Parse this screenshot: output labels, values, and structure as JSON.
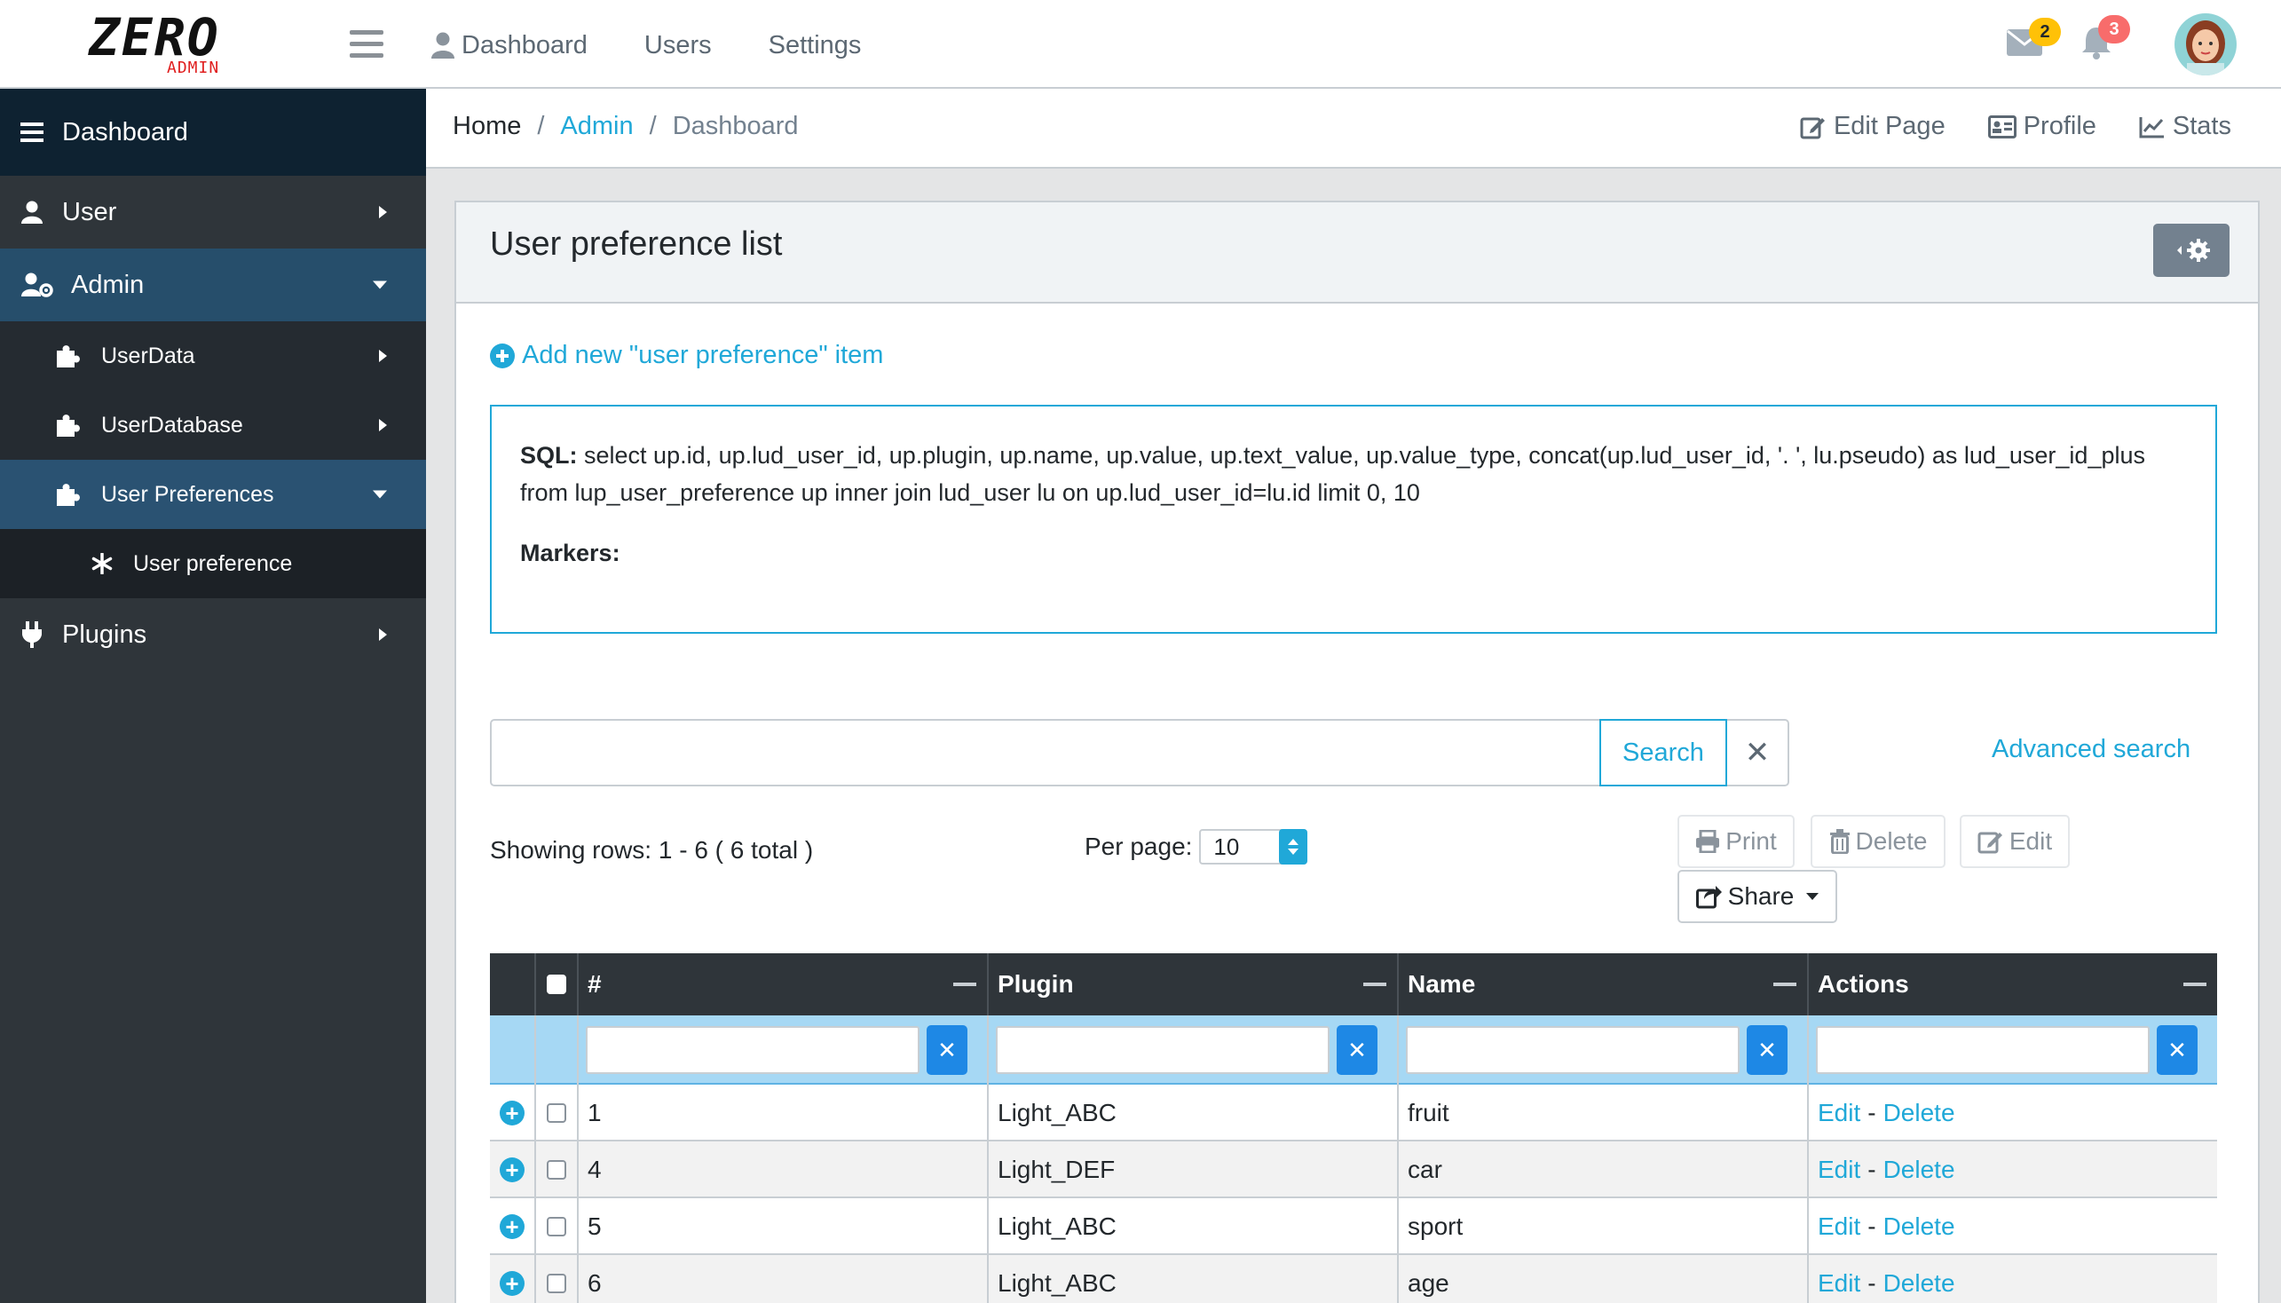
{
  "brand": {
    "main": "ZERO",
    "sub": "ADMIN"
  },
  "topnav": {
    "links": [
      "Dashboard",
      "Users",
      "Settings"
    ],
    "mail_badge": "2",
    "bell_badge": "3"
  },
  "sidebar": {
    "dashboard": "Dashboard",
    "user": "User",
    "admin": "Admin",
    "userdata": "UserData",
    "userdatabase": "UserDatabase",
    "user_preferences": "User Preferences",
    "user_preference": "User preference",
    "plugins": "Plugins"
  },
  "breadcrumb": {
    "home": "Home",
    "admin": "Admin",
    "current": "Dashboard"
  },
  "header_menu": {
    "edit_page": "Edit Page",
    "profile": "Profile",
    "stats": "Stats"
  },
  "card": {
    "title": "User preference list",
    "add_link": "Add new \"user preference\" item",
    "sql_label": "SQL:",
    "sql_text": "select up.id, up.lud_user_id, up.plugin, up.name, up.value, up.text_value, up.value_type, concat(up.lud_user_id, '. ', lu.pseudo) as lud_user_id_plus from lup_user_preference up inner join lud_user lu on up.lud_user_id=lu.id limit 0, 10",
    "markers_label": "Markers:"
  },
  "search": {
    "value": "",
    "button": "Search",
    "clear": "✕",
    "advanced": "Advanced search"
  },
  "pagination": {
    "showing": "Showing rows: 1 - 6 ( 6 total )",
    "per_page_label": "Per page:",
    "per_page_value": "10"
  },
  "actions": {
    "print": "Print",
    "delete": "Delete",
    "edit": "Edit",
    "share": "Share"
  },
  "table": {
    "headers": [
      "#",
      "Plugin",
      "Name",
      "Actions"
    ],
    "rows": [
      {
        "id": "1",
        "plugin": "Light_ABC",
        "name": "fruit",
        "edit": "Edit",
        "sep": "-",
        "delete": "Delete"
      },
      {
        "id": "4",
        "plugin": "Light_DEF",
        "name": "car",
        "edit": "Edit",
        "sep": "-",
        "delete": "Delete"
      },
      {
        "id": "5",
        "plugin": "Light_ABC",
        "name": "sport",
        "edit": "Edit",
        "sep": "-",
        "delete": "Delete"
      },
      {
        "id": "6",
        "plugin": "Light_ABC",
        "name": "age",
        "edit": "Edit",
        "sep": "-",
        "delete": "Delete"
      }
    ]
  },
  "colors": {
    "accent": "#20a8d8",
    "sidebar": "#2f353a",
    "sidebar_active": "#264e6b"
  }
}
